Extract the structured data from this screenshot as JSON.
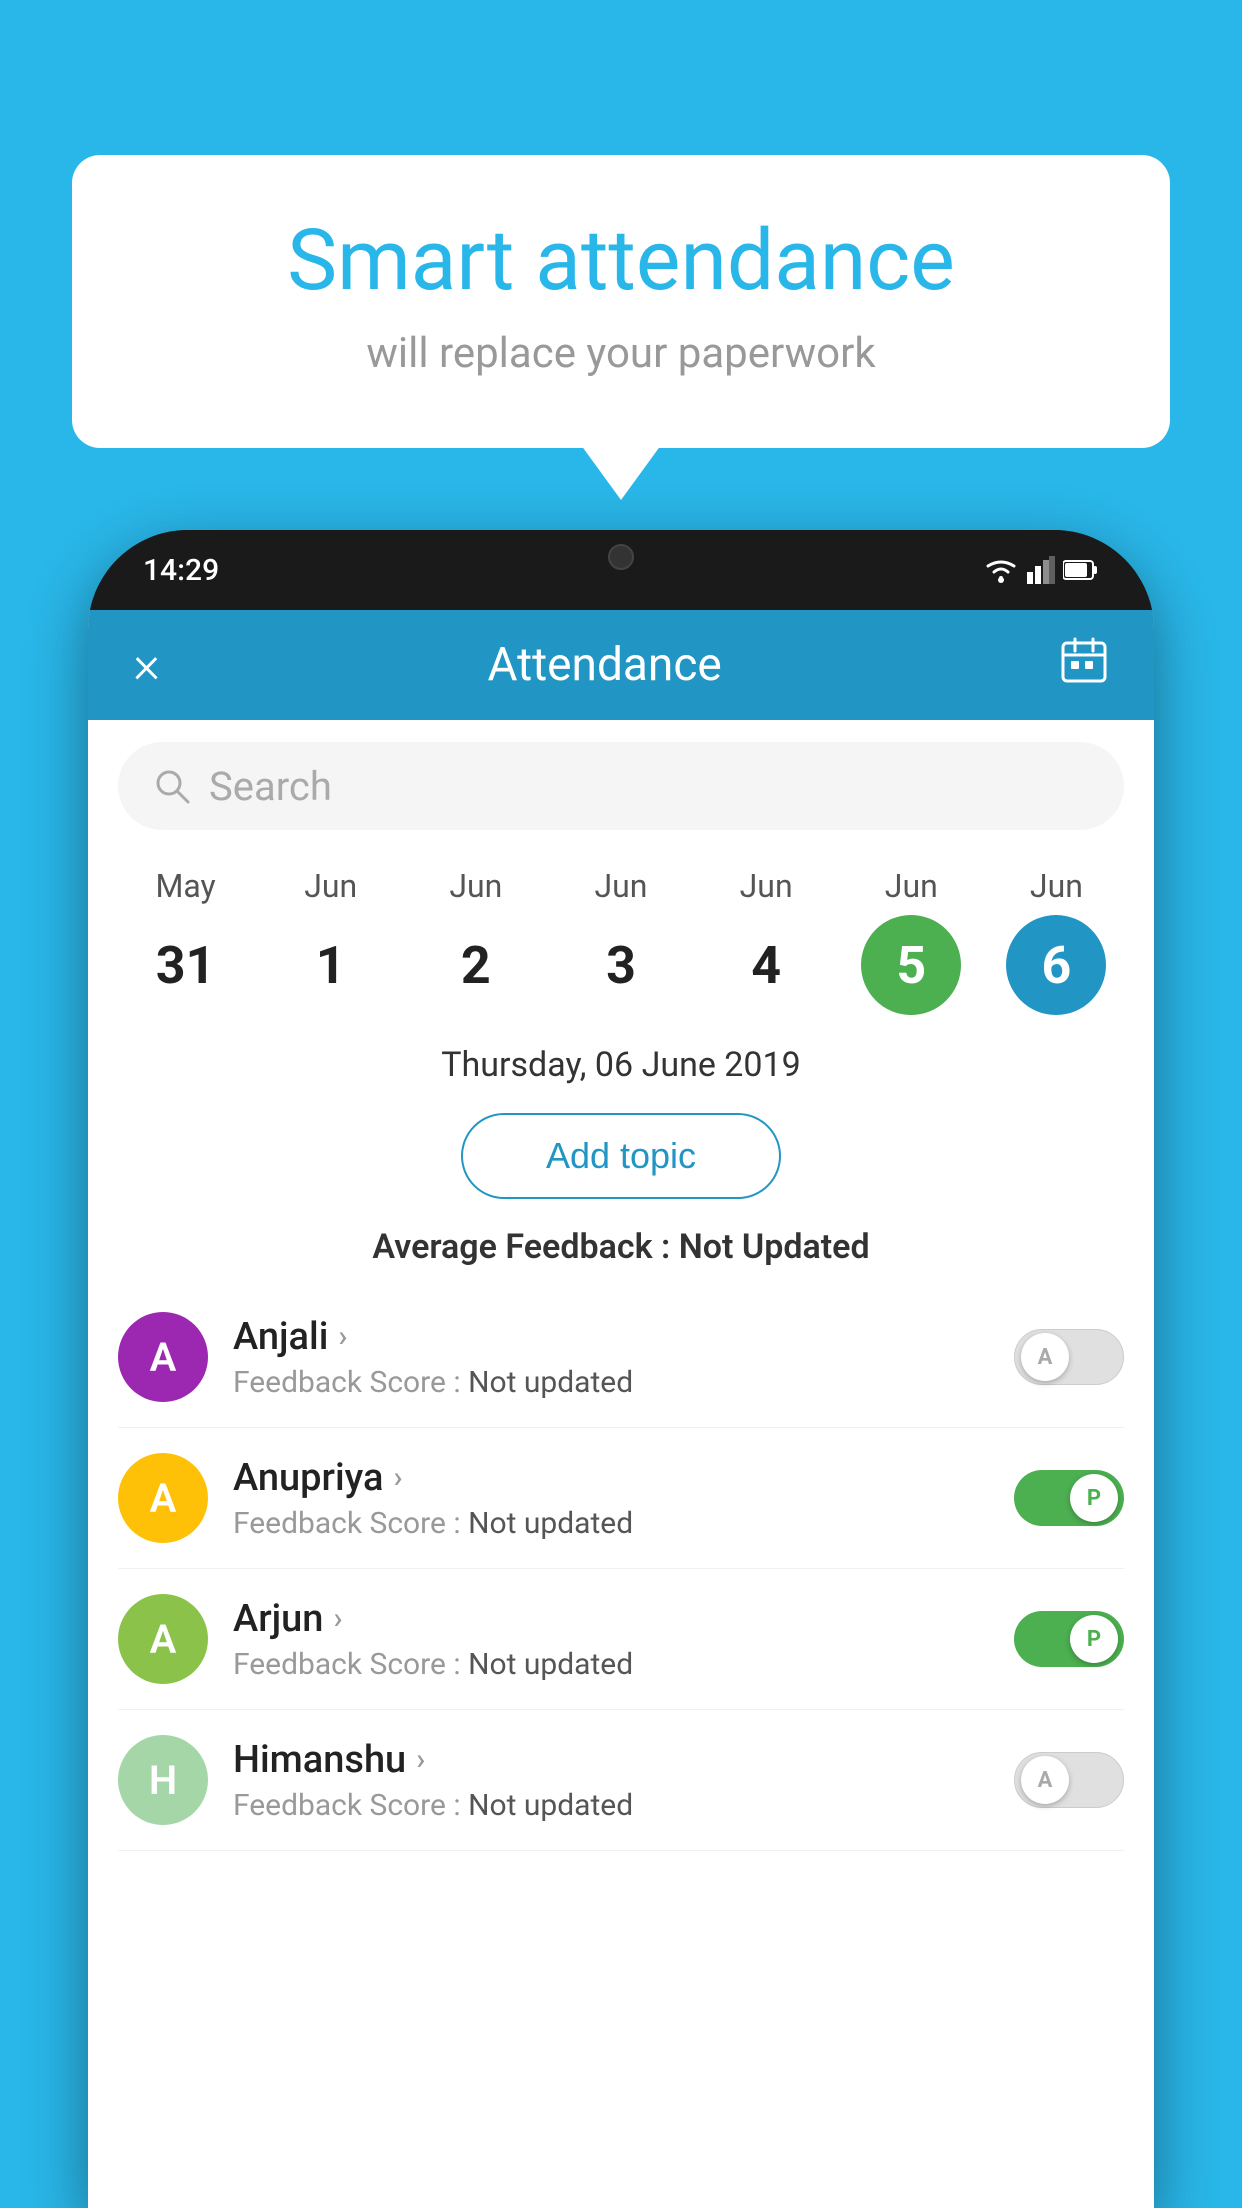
{
  "background_color": "#29b6e8",
  "bubble": {
    "title": "Smart attendance",
    "subtitle": "will replace your paperwork"
  },
  "phone": {
    "status_bar": {
      "time": "14:29"
    },
    "header": {
      "close_label": "×",
      "title": "Attendance",
      "calendar_icon": "calendar-icon"
    },
    "search": {
      "placeholder": "Search"
    },
    "calendar": {
      "dates": [
        {
          "month": "May",
          "day": "31",
          "state": "normal"
        },
        {
          "month": "Jun",
          "day": "1",
          "state": "normal"
        },
        {
          "month": "Jun",
          "day": "2",
          "state": "normal"
        },
        {
          "month": "Jun",
          "day": "3",
          "state": "normal"
        },
        {
          "month": "Jun",
          "day": "4",
          "state": "normal"
        },
        {
          "month": "Jun",
          "day": "5",
          "state": "today"
        },
        {
          "month": "Jun",
          "day": "6",
          "state": "selected"
        }
      ]
    },
    "selected_date": "Thursday, 06 June 2019",
    "add_topic_label": "Add topic",
    "avg_feedback_label": "Average Feedback : ",
    "avg_feedback_value": "Not Updated",
    "students": [
      {
        "name": "Anjali",
        "initial": "A",
        "avatar_color": "#9c27b0",
        "feedback_label": "Feedback Score : ",
        "feedback_value": "Not updated",
        "attendance": "absent"
      },
      {
        "name": "Anupriya",
        "initial": "A",
        "avatar_color": "#ffc107",
        "feedback_label": "Feedback Score : ",
        "feedback_value": "Not updated",
        "attendance": "present"
      },
      {
        "name": "Arjun",
        "initial": "A",
        "avatar_color": "#8bc34a",
        "feedback_label": "Feedback Score : ",
        "feedback_value": "Not updated",
        "attendance": "present"
      },
      {
        "name": "Himanshu",
        "initial": "H",
        "avatar_color": "#a5d6a7",
        "feedback_label": "Feedback Score : ",
        "feedback_value": "Not updated",
        "attendance": "absent"
      }
    ]
  }
}
